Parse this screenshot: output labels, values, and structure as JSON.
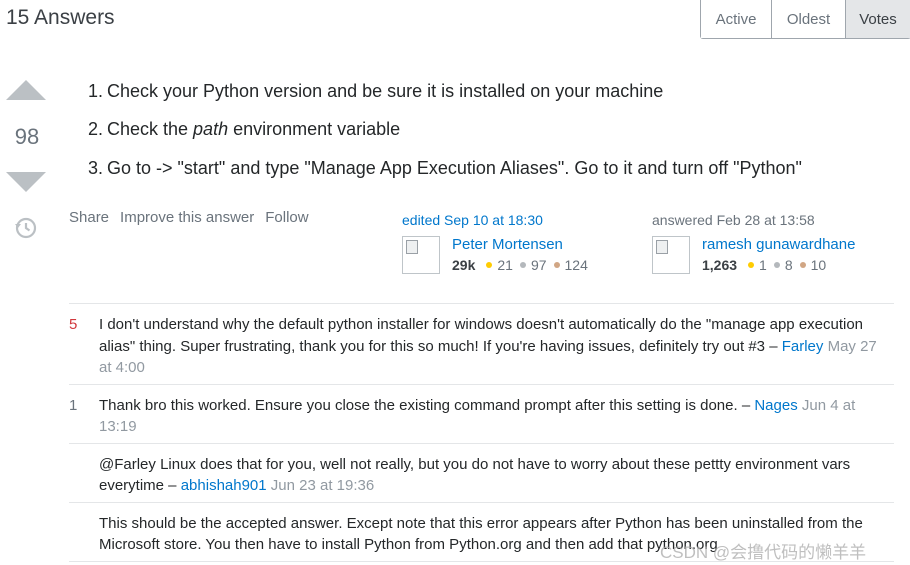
{
  "header": {
    "answers_count": "15 Answers"
  },
  "sort_tabs": [
    {
      "label": "Active",
      "active": false
    },
    {
      "label": "Oldest",
      "active": false
    },
    {
      "label": "Votes",
      "active": true
    }
  ],
  "vote": {
    "score": "98",
    "up_icon": "upvote-arrow-icon",
    "down_icon": "downvote-arrow-icon",
    "history_icon": "history-icon"
  },
  "post": {
    "items": [
      {
        "num": "1.",
        "text": "Check your Python version and be sure it is installed on your machine"
      },
      {
        "num": "2.",
        "pre": "Check the ",
        "em": "path",
        "post": " environment variable"
      },
      {
        "num": "3.",
        "text": "Go to -> \"start\" and type \"Manage App Execution Aliases\". Go to it and turn off \"Python\""
      }
    ]
  },
  "menu": {
    "share": "Share",
    "improve": "Improve this answer",
    "follow": "Follow"
  },
  "edited": {
    "label": "edited Sep 10 at 18:30",
    "user": "Peter Mortensen",
    "rep": "29k",
    "gold": "21",
    "silver": "97",
    "bronze": "124"
  },
  "answered": {
    "label": "answered Feb 28 at 13:58",
    "user": "ramesh gunawardhane",
    "rep": "1,263",
    "gold": "1",
    "silver": "8",
    "bronze": "10"
  },
  "comments": [
    {
      "score": "5",
      "text": "I don't understand why the default python installer for windows doesn't automatically do the \"manage app execution alias\" thing. Super frustrating, thank you for this so much! If you're having issues, definitely try out #3 – ",
      "user": "Farley",
      "date": "May 27 at 4:00"
    },
    {
      "score": "1",
      "text": "Thank bro this worked. Ensure you close the existing command prompt after this setting is done. – ",
      "user": "Nages",
      "date": "Jun 4 at 13:19"
    },
    {
      "score": "",
      "text": "@Farley Linux does that for you, well not really, but you do not have to worry about these pettty environment vars everytime – ",
      "user": "abhishah901",
      "date": "Jun 23 at 19:36"
    },
    {
      "score": "",
      "text": "This should be the accepted answer. Except note that this error appears after Python has been uninstalled from the Microsoft store. You then have to install Python from Python.org and then add that python.org",
      "user": "",
      "date": ""
    }
  ],
  "colors": {
    "link": "#0077cc",
    "gold": "#ffcc01",
    "silver": "#b4b8bc",
    "bronze": "#d1a684"
  },
  "watermark": "CSDN @会撸代码的懒羊羊"
}
